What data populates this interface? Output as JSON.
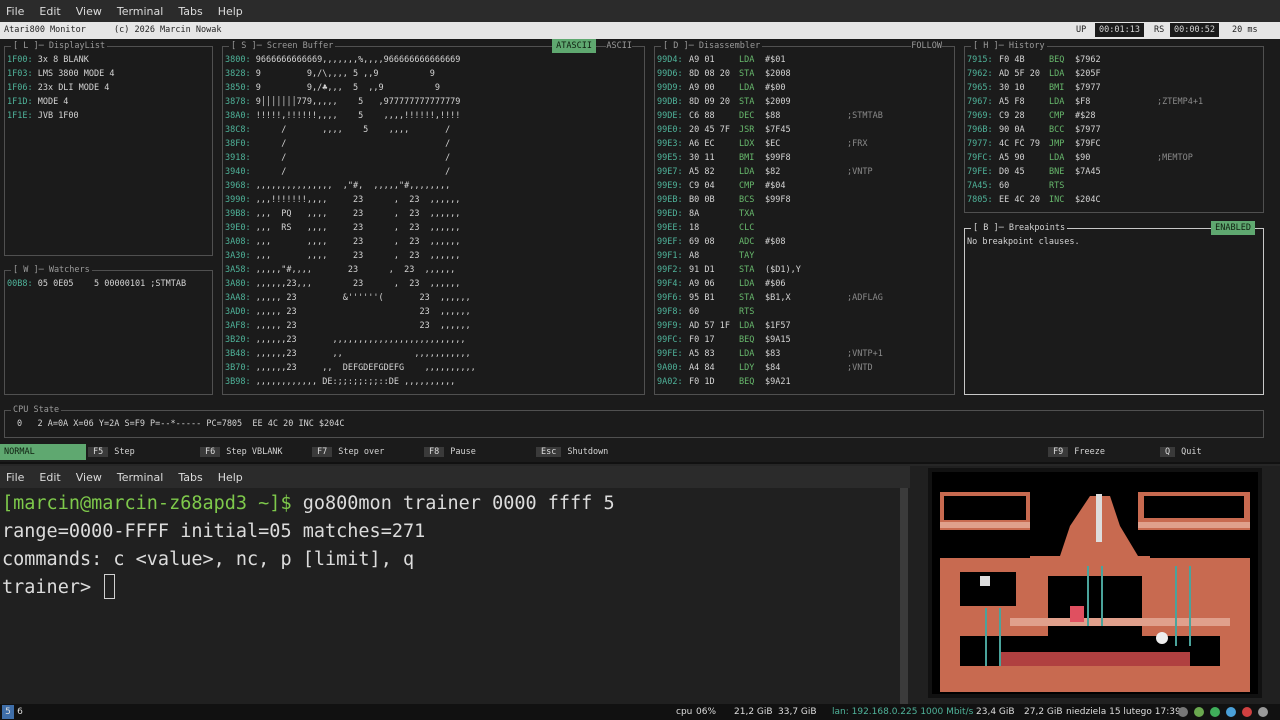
{
  "menu": [
    "File",
    "Edit",
    "View",
    "Terminal",
    "Tabs",
    "Help"
  ],
  "monitor": {
    "title": "Atari800 Monitor",
    "copyright": "(c) 2026 Marcin Nowak",
    "up_label": "UP",
    "up_time": "00:01:13",
    "rs_label": "RS",
    "rs_time": "00:00:52",
    "ms": "20 ms"
  },
  "displaylist": {
    "title": "[ L ]─ DisplayList",
    "rows": [
      {
        "addr": "1F00:",
        "text": "3x 8 BLANK"
      },
      {
        "addr": "1F03:",
        "text": "LMS 3800 MODE 4"
      },
      {
        "addr": "1F06:",
        "text": "23x DLI MODE 4"
      },
      {
        "addr": "1F1D:",
        "text": "MODE 4"
      },
      {
        "addr": "1F1E:",
        "text": "JVB 1F00"
      }
    ]
  },
  "watchers": {
    "title": "[ W ]─ Watchers",
    "rows": [
      {
        "addr": "00B8:",
        "text": "05 0E05    5 00000101 ;STMTAB"
      }
    ]
  },
  "screen_buffer": {
    "title": "[ S ]─ Screen Buffer",
    "mode_active": "ATASCII",
    "mode_other": "ASCII",
    "rows": [
      {
        "addr": "3800:",
        "text": "9666666666669,,,,,,,%,,,,966666666666669"
      },
      {
        "addr": "3828:",
        "text": "9         9,/\\,,,, 5 ,,9          9"
      },
      {
        "addr": "3850:",
        "text": "9         9,/♣,,,  5  ,,9          9"
      },
      {
        "addr": "3878:",
        "text": "9│││││││779,,,,,    5   ,977777777777779"
      },
      {
        "addr": "38A0:",
        "text": "!!!!!,!!!!!!,,,,    5    ,,,,!!!!!!,!!!!"
      },
      {
        "addr": "38C8:",
        "text": "     /       ,,,,    5    ,,,,       /"
      },
      {
        "addr": "38F0:",
        "text": "     /                               /"
      },
      {
        "addr": "3918:",
        "text": "     /                               /"
      },
      {
        "addr": "3940:",
        "text": "     /                               /"
      },
      {
        "addr": "3968:",
        "text": ",,,,,,,,,,,,,,,  ,\"#,  ,,,,,\"#,,,,,,,,"
      },
      {
        "addr": "3990:",
        "text": ",,,!!!!!!!,,,,     23      ,  23  ,,,,,,"
      },
      {
        "addr": "39B8:",
        "text": ",,,  PQ   ,,,,     23      ,  23  ,,,,,,"
      },
      {
        "addr": "39E0:",
        "text": ",,,  RS   ,,,,     23      ,  23  ,,,,,,"
      },
      {
        "addr": "3A08:",
        "text": ",,,       ,,,,     23      ,  23  ,,,,,,"
      },
      {
        "addr": "3A30:",
        "text": ",,,       ,,,,     23      ,  23  ,,,,,,"
      },
      {
        "addr": "3A58:",
        "text": ",,,,,\"#,,,,       23      ,  23  ,,,,,,"
      },
      {
        "addr": "3A80:",
        "text": ",,,,,,23,,,        23      ,  23  ,,,,,,"
      },
      {
        "addr": "3AA8:",
        "text": ",,,,, 23         &''''''(       23  ,,,,,,"
      },
      {
        "addr": "3AD0:",
        "text": ",,,,, 23                        23  ,,,,,,"
      },
      {
        "addr": "3AF8:",
        "text": ",,,,, 23                        23  ,,,,,,"
      },
      {
        "addr": "3B20:",
        "text": ",,,,,,23       ,,,,,,,,,,,,,,,,,,,,,,,,,,"
      },
      {
        "addr": "3B48:",
        "text": ",,,,,,23       ,,              ,,,,,,,,,,,"
      },
      {
        "addr": "3B70:",
        "text": ",,,,,,23     ,,  DEFGDEFGDEFG    ,,,,,,,,,,"
      },
      {
        "addr": "3B98:",
        "text": ",,,,,,,,,,,, DE:;;:;;:;;::DE ,,,,,,,,,,"
      }
    ]
  },
  "disassembler": {
    "title": "[ D ]─ Disassembler",
    "follow": "FOLLOW",
    "rows": [
      {
        "addr": "99D4:",
        "bytes": "A9 01",
        "mn": "LDA",
        "op": "#$01",
        "cmt": ""
      },
      {
        "addr": "99D6:",
        "bytes": "8D 08 20",
        "mn": "STA",
        "op": "$2008",
        "cmt": ""
      },
      {
        "addr": "99D9:",
        "bytes": "A9 00",
        "mn": "LDA",
        "op": "#$00",
        "cmt": ""
      },
      {
        "addr": "99DB:",
        "bytes": "8D 09 20",
        "mn": "STA",
        "op": "$2009",
        "cmt": ""
      },
      {
        "addr": "99DE:",
        "bytes": "C6 88",
        "mn": "DEC",
        "op": "$88",
        "cmt": ";STMTAB"
      },
      {
        "addr": "99E0:",
        "bytes": "20 45 7F",
        "mn": "JSR",
        "op": "$7F45",
        "cmt": ""
      },
      {
        "addr": "99E3:",
        "bytes": "A6 EC",
        "mn": "LDX",
        "op": "$EC",
        "cmt": ";FRX"
      },
      {
        "addr": "99E5:",
        "bytes": "30 11",
        "mn": "BMI",
        "op": "$99F8",
        "cmt": ""
      },
      {
        "addr": "99E7:",
        "bytes": "A5 82",
        "mn": "LDA",
        "op": "$82",
        "cmt": ";VNTP"
      },
      {
        "addr": "99E9:",
        "bytes": "C9 04",
        "mn": "CMP",
        "op": "#$04",
        "cmt": ""
      },
      {
        "addr": "99EB:",
        "bytes": "B0 0B",
        "mn": "BCS",
        "op": "$99F8",
        "cmt": ""
      },
      {
        "addr": "99ED:",
        "bytes": "8A",
        "mn": "TXA",
        "op": "",
        "cmt": ""
      },
      {
        "addr": "99EE:",
        "bytes": "18",
        "mn": "CLC",
        "op": "",
        "cmt": ""
      },
      {
        "addr": "99EF:",
        "bytes": "69 08",
        "mn": "ADC",
        "op": "#$08",
        "cmt": ""
      },
      {
        "addr": "99F1:",
        "bytes": "A8",
        "mn": "TAY",
        "op": "",
        "cmt": ""
      },
      {
        "addr": "99F2:",
        "bytes": "91 D1",
        "mn": "STA",
        "op": "($D1),Y",
        "cmt": ""
      },
      {
        "addr": "99F4:",
        "bytes": "A9 06",
        "mn": "LDA",
        "op": "#$06",
        "cmt": ""
      },
      {
        "addr": "99F6:",
        "bytes": "95 B1",
        "mn": "STA",
        "op": "$B1,X",
        "cmt": ";ADFLAG"
      },
      {
        "addr": "99F8:",
        "bytes": "60",
        "mn": "RTS",
        "op": "",
        "cmt": ""
      },
      {
        "addr": "99F9:",
        "bytes": "AD 57 1F",
        "mn": "LDA",
        "op": "$1F57",
        "cmt": ""
      },
      {
        "addr": "99FC:",
        "bytes": "F0 17",
        "mn": "BEQ",
        "op": "$9A15",
        "cmt": ""
      },
      {
        "addr": "99FE:",
        "bytes": "A5 83",
        "mn": "LDA",
        "op": "$83",
        "cmt": ";VNTP+1"
      },
      {
        "addr": "9A00:",
        "bytes": "A4 84",
        "mn": "LDY",
        "op": "$84",
        "cmt": ";VNTD"
      },
      {
        "addr": "9A02:",
        "bytes": "F0 1D",
        "mn": "BEQ",
        "op": "$9A21",
        "cmt": ""
      }
    ]
  },
  "history": {
    "title": "[ H ]─ History",
    "rows": [
      {
        "addr": "7915:",
        "bytes": "F0 4B",
        "mn": "BEQ",
        "op": "$7962",
        "cmt": ""
      },
      {
        "addr": "7962:",
        "bytes": "AD 5F 20",
        "mn": "LDA",
        "op": "$205F",
        "cmt": ""
      },
      {
        "addr": "7965:",
        "bytes": "30 10",
        "mn": "BMI",
        "op": "$7977",
        "cmt": ""
      },
      {
        "addr": "7967:",
        "bytes": "A5 F8",
        "mn": "LDA",
        "op": "$F8",
        "cmt": ";ZTEMP4+1"
      },
      {
        "addr": "7969:",
        "bytes": "C9 28",
        "mn": "CMP",
        "op": "#$28",
        "cmt": ""
      },
      {
        "addr": "796B:",
        "bytes": "90 0A",
        "mn": "BCC",
        "op": "$7977",
        "cmt": ""
      },
      {
        "addr": "7977:",
        "bytes": "4C FC 79",
        "mn": "JMP",
        "op": "$79FC",
        "cmt": ""
      },
      {
        "addr": "79FC:",
        "bytes": "A5 90",
        "mn": "LDA",
        "op": "$90",
        "cmt": ";MEMTOP"
      },
      {
        "addr": "79FE:",
        "bytes": "D0 45",
        "mn": "BNE",
        "op": "$7A45",
        "cmt": ""
      },
      {
        "addr": "7A45:",
        "bytes": "60",
        "mn": "RTS",
        "op": "",
        "cmt": ""
      },
      {
        "addr": "7805:",
        "bytes": "EE 4C 20",
        "mn": "INC",
        "op": "$204C",
        "cmt": ""
      }
    ]
  },
  "breakpoints": {
    "title": "[ B ]─ Breakpoints",
    "badge": "ENABLED",
    "text": "No breakpoint clauses."
  },
  "cpu": {
    "title": "CPU State",
    "line": "0   2 A=0A X=06 Y=2A S=F9 P=--*----- PC=7805  EE 4C 20 INC $204C"
  },
  "fkeys": {
    "mode": "NORMAL",
    "items": [
      {
        "key": "F5",
        "label": "Step"
      },
      {
        "key": "F6",
        "label": "Step VBLANK"
      },
      {
        "key": "F7",
        "label": "Step over"
      },
      {
        "key": "F8",
        "label": "Pause"
      },
      {
        "key": "Esc",
        "label": "Shutdown"
      },
      {
        "key": "F9",
        "label": "Freeze"
      },
      {
        "key": "Q",
        "label": "Quit"
      }
    ]
  },
  "terminal2": {
    "prompt": "[marcin@marcin-z68apd3 ~]$",
    "command": " go800mon trainer 0000 ffff 5",
    "line2": "range=0000-FFFF initial=05 matches=271",
    "line3": "commands: c <value>, nc, p [limit], q",
    "line4": "trainer>"
  },
  "taskbar": {
    "ws1": "5",
    "ws2": "6",
    "cpu_label": "cpu",
    "cpu": "06%",
    "mem": "21,2 GiB",
    "disk": "33,7 GiB",
    "lan": "lan: 192.168.0.225 1000 Mbit/s",
    "ram2": "23,4 GiB",
    "ram3": "27,2 GiB",
    "date": "niedziela 15 lutego 17:39"
  }
}
